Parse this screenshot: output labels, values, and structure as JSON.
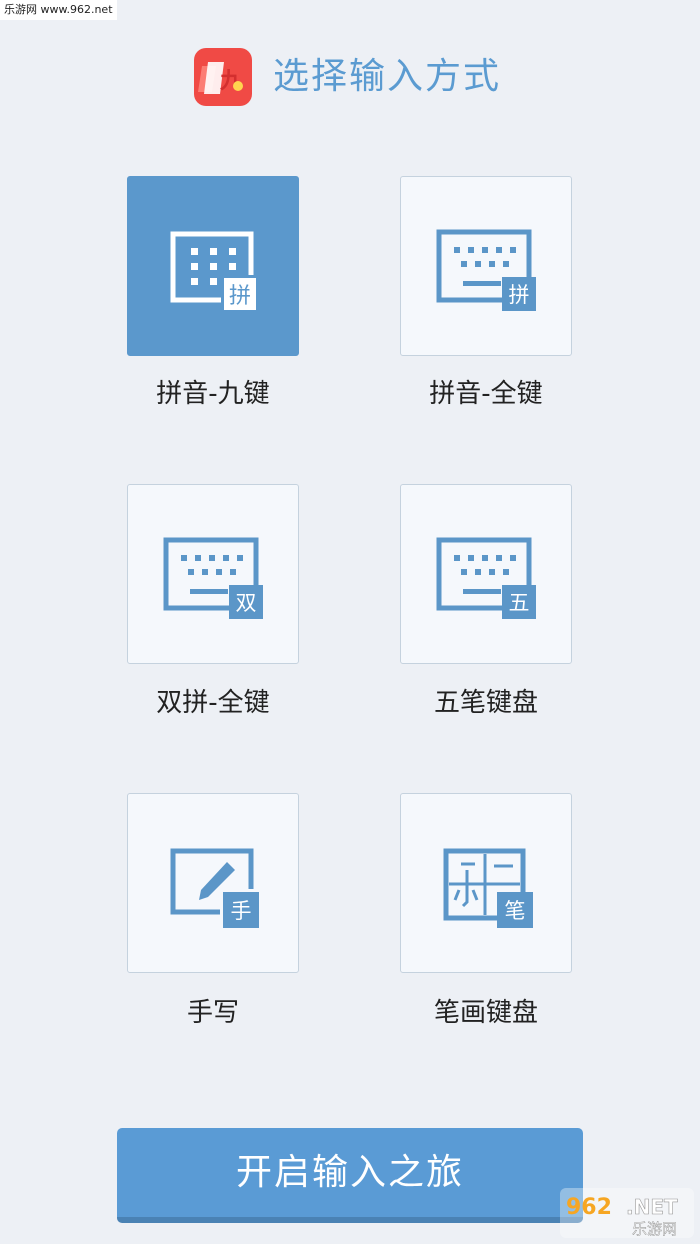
{
  "watermark_top": "乐游网 www.962.net",
  "header": {
    "title": "选择输入方式"
  },
  "modes": [
    {
      "label": "拼音-九键",
      "badge": "拼",
      "icon": "keypad-9key-icon",
      "selected": true
    },
    {
      "label": "拼音-全键",
      "badge": "拼",
      "icon": "keyboard-full-icon",
      "selected": false
    },
    {
      "label": "双拼-全键",
      "badge": "双",
      "icon": "keyboard-full-icon",
      "selected": false
    },
    {
      "label": "五笔键盘",
      "badge": "五",
      "icon": "keyboard-full-icon",
      "selected": false
    },
    {
      "label": "手写",
      "badge": "手",
      "icon": "handwriting-pencil-icon",
      "selected": false
    },
    {
      "label": "笔画键盘",
      "badge": "笔",
      "icon": "stroke-keyboard-icon",
      "selected": false
    }
  ],
  "start_button": "开启输入之旅",
  "watermark_bottom": {
    "number": "962",
    "net": ".NET",
    "text": "乐游网"
  },
  "colors": {
    "accent": "#5a9bd5",
    "selected_tile": "#5b98cc",
    "icon_blue": "#5b96c8",
    "logo_red": "#f04a45",
    "background": "#edf0f5"
  }
}
